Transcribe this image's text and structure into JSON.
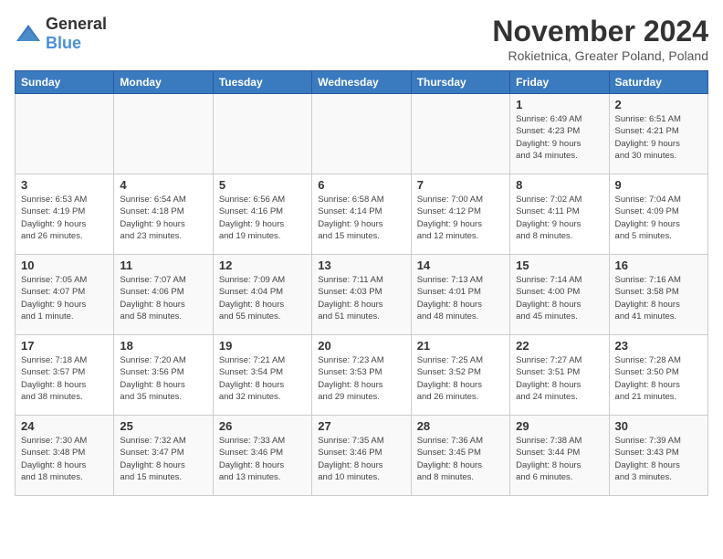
{
  "header": {
    "logo_general": "General",
    "logo_blue": "Blue",
    "title": "November 2024",
    "subtitle": "Rokietnica, Greater Poland, Poland"
  },
  "weekdays": [
    "Sunday",
    "Monday",
    "Tuesday",
    "Wednesday",
    "Thursday",
    "Friday",
    "Saturday"
  ],
  "weeks": [
    [
      {
        "day": "",
        "info": ""
      },
      {
        "day": "",
        "info": ""
      },
      {
        "day": "",
        "info": ""
      },
      {
        "day": "",
        "info": ""
      },
      {
        "day": "",
        "info": ""
      },
      {
        "day": "1",
        "info": "Sunrise: 6:49 AM\nSunset: 4:23 PM\nDaylight: 9 hours\nand 34 minutes."
      },
      {
        "day": "2",
        "info": "Sunrise: 6:51 AM\nSunset: 4:21 PM\nDaylight: 9 hours\nand 30 minutes."
      }
    ],
    [
      {
        "day": "3",
        "info": "Sunrise: 6:53 AM\nSunset: 4:19 PM\nDaylight: 9 hours\nand 26 minutes."
      },
      {
        "day": "4",
        "info": "Sunrise: 6:54 AM\nSunset: 4:18 PM\nDaylight: 9 hours\nand 23 minutes."
      },
      {
        "day": "5",
        "info": "Sunrise: 6:56 AM\nSunset: 4:16 PM\nDaylight: 9 hours\nand 19 minutes."
      },
      {
        "day": "6",
        "info": "Sunrise: 6:58 AM\nSunset: 4:14 PM\nDaylight: 9 hours\nand 15 minutes."
      },
      {
        "day": "7",
        "info": "Sunrise: 7:00 AM\nSunset: 4:12 PM\nDaylight: 9 hours\nand 12 minutes."
      },
      {
        "day": "8",
        "info": "Sunrise: 7:02 AM\nSunset: 4:11 PM\nDaylight: 9 hours\nand 8 minutes."
      },
      {
        "day": "9",
        "info": "Sunrise: 7:04 AM\nSunset: 4:09 PM\nDaylight: 9 hours\nand 5 minutes."
      }
    ],
    [
      {
        "day": "10",
        "info": "Sunrise: 7:05 AM\nSunset: 4:07 PM\nDaylight: 9 hours\nand 1 minute."
      },
      {
        "day": "11",
        "info": "Sunrise: 7:07 AM\nSunset: 4:06 PM\nDaylight: 8 hours\nand 58 minutes."
      },
      {
        "day": "12",
        "info": "Sunrise: 7:09 AM\nSunset: 4:04 PM\nDaylight: 8 hours\nand 55 minutes."
      },
      {
        "day": "13",
        "info": "Sunrise: 7:11 AM\nSunset: 4:03 PM\nDaylight: 8 hours\nand 51 minutes."
      },
      {
        "day": "14",
        "info": "Sunrise: 7:13 AM\nSunset: 4:01 PM\nDaylight: 8 hours\nand 48 minutes."
      },
      {
        "day": "15",
        "info": "Sunrise: 7:14 AM\nSunset: 4:00 PM\nDaylight: 8 hours\nand 45 minutes."
      },
      {
        "day": "16",
        "info": "Sunrise: 7:16 AM\nSunset: 3:58 PM\nDaylight: 8 hours\nand 41 minutes."
      }
    ],
    [
      {
        "day": "17",
        "info": "Sunrise: 7:18 AM\nSunset: 3:57 PM\nDaylight: 8 hours\nand 38 minutes."
      },
      {
        "day": "18",
        "info": "Sunrise: 7:20 AM\nSunset: 3:56 PM\nDaylight: 8 hours\nand 35 minutes."
      },
      {
        "day": "19",
        "info": "Sunrise: 7:21 AM\nSunset: 3:54 PM\nDaylight: 8 hours\nand 32 minutes."
      },
      {
        "day": "20",
        "info": "Sunrise: 7:23 AM\nSunset: 3:53 PM\nDaylight: 8 hours\nand 29 minutes."
      },
      {
        "day": "21",
        "info": "Sunrise: 7:25 AM\nSunset: 3:52 PM\nDaylight: 8 hours\nand 26 minutes."
      },
      {
        "day": "22",
        "info": "Sunrise: 7:27 AM\nSunset: 3:51 PM\nDaylight: 8 hours\nand 24 minutes."
      },
      {
        "day": "23",
        "info": "Sunrise: 7:28 AM\nSunset: 3:50 PM\nDaylight: 8 hours\nand 21 minutes."
      }
    ],
    [
      {
        "day": "24",
        "info": "Sunrise: 7:30 AM\nSunset: 3:48 PM\nDaylight: 8 hours\nand 18 minutes."
      },
      {
        "day": "25",
        "info": "Sunrise: 7:32 AM\nSunset: 3:47 PM\nDaylight: 8 hours\nand 15 minutes."
      },
      {
        "day": "26",
        "info": "Sunrise: 7:33 AM\nSunset: 3:46 PM\nDaylight: 8 hours\nand 13 minutes."
      },
      {
        "day": "27",
        "info": "Sunrise: 7:35 AM\nSunset: 3:46 PM\nDaylight: 8 hours\nand 10 minutes."
      },
      {
        "day": "28",
        "info": "Sunrise: 7:36 AM\nSunset: 3:45 PM\nDaylight: 8 hours\nand 8 minutes."
      },
      {
        "day": "29",
        "info": "Sunrise: 7:38 AM\nSunset: 3:44 PM\nDaylight: 8 hours\nand 6 minutes."
      },
      {
        "day": "30",
        "info": "Sunrise: 7:39 AM\nSunset: 3:43 PM\nDaylight: 8 hours\nand 3 minutes."
      }
    ]
  ]
}
